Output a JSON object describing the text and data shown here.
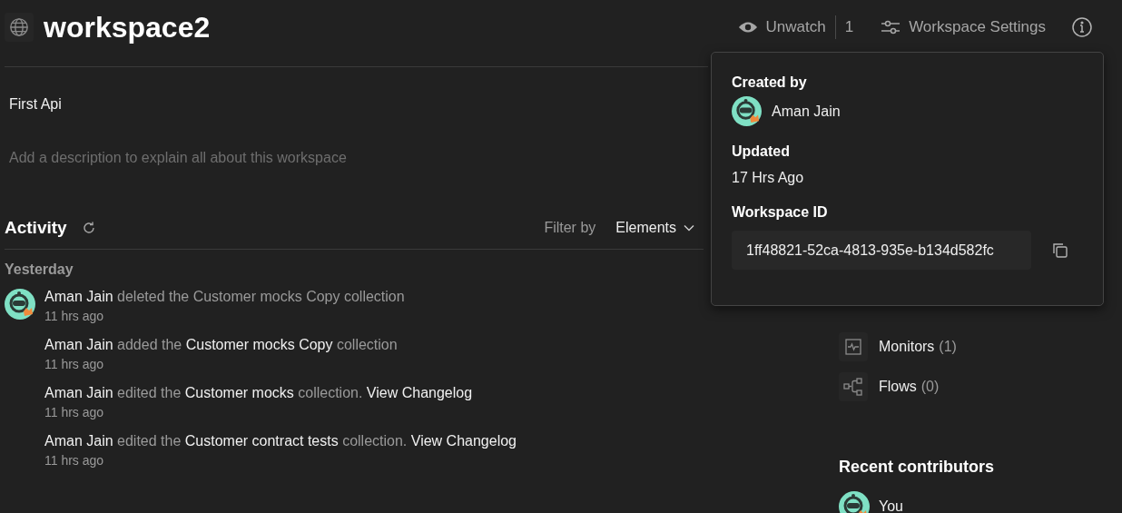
{
  "workspace": {
    "title": "workspace2",
    "summary": "First Api",
    "description_placeholder": "Add a description to explain all about this workspace"
  },
  "header_actions": {
    "watch_label": "Unwatch",
    "watch_count": "1",
    "settings_label": "Workspace Settings"
  },
  "info_popover": {
    "created_label": "Created by",
    "creator": "Aman Jain",
    "updated_label": "Updated",
    "updated": "17 Hrs Ago",
    "id_label": "Workspace ID",
    "workspace_id": "1ff48821-52ca-4813-935e-b134d582fc"
  },
  "activity": {
    "title": "Activity",
    "filter_label": "Filter by",
    "filter_value": "Elements",
    "groups": [
      {
        "label": "Yesterday",
        "items": [
          {
            "avatar": true,
            "time": "11 hrs ago",
            "parts": [
              {
                "kind": "actor",
                "text": "Aman Jain"
              },
              {
                "kind": "text",
                "text": " deleted the Customer mocks Copy collection"
              }
            ]
          },
          {
            "avatar": false,
            "time": "11 hrs ago",
            "parts": [
              {
                "kind": "actor",
                "text": "Aman Jain"
              },
              {
                "kind": "text",
                "text": " added the "
              },
              {
                "kind": "object",
                "text": "Customer mocks Copy"
              },
              {
                "kind": "text",
                "text": " collection"
              }
            ]
          },
          {
            "avatar": false,
            "time": "11 hrs ago",
            "parts": [
              {
                "kind": "actor",
                "text": "Aman Jain"
              },
              {
                "kind": "text",
                "text": " edited the "
              },
              {
                "kind": "object",
                "text": "Customer mocks"
              },
              {
                "kind": "text",
                "text": " collection. "
              },
              {
                "kind": "link",
                "text": "View Changelog"
              }
            ]
          },
          {
            "avatar": false,
            "time": "11 hrs ago",
            "parts": [
              {
                "kind": "actor",
                "text": "Aman Jain"
              },
              {
                "kind": "text",
                "text": " edited the "
              },
              {
                "kind": "object",
                "text": "Customer contract tests"
              },
              {
                "kind": "text",
                "text": " collection. "
              },
              {
                "kind": "link",
                "text": "View Changelog"
              }
            ]
          }
        ]
      }
    ]
  },
  "sidebar": {
    "elements": [
      {
        "kind": "monitor",
        "name": "Monitors",
        "count": "(1)"
      },
      {
        "kind": "flow",
        "name": "Flows",
        "count": "(0)"
      }
    ],
    "contributors_title": "Recent contributors",
    "contributors": [
      {
        "name": "You"
      }
    ]
  }
}
